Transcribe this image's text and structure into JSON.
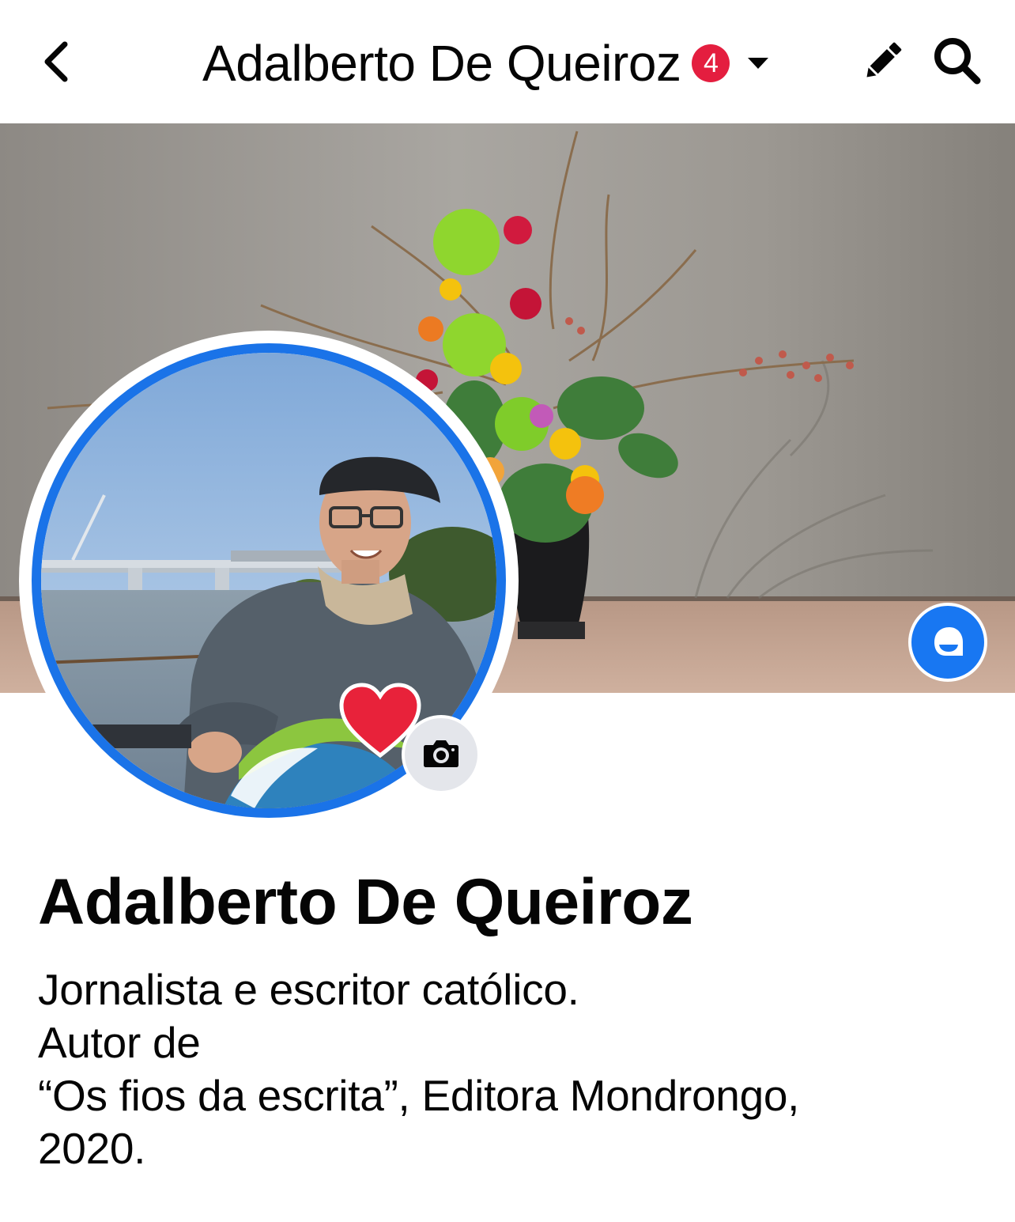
{
  "header": {
    "back_icon": "chevron-left-icon",
    "title": "Adalberto De Queiroz",
    "notification_count": "4",
    "badge_color": "#e41e3f",
    "dropdown_icon": "caret-down-icon",
    "edit_icon": "pencil-icon",
    "search_icon": "search-icon"
  },
  "cover": {
    "description_icon": "cover-photo",
    "buttons": [
      {
        "icon": "avatar-frame-icon",
        "color": "#1877f2"
      },
      {
        "icon": "camera-icon",
        "color": "#e4e6eb"
      }
    ]
  },
  "avatar": {
    "ring_color": "#1a73e8",
    "frame_icon": "heart-icon",
    "camera_icon": "camera-icon"
  },
  "profile": {
    "name": "Adalberto De Queiroz",
    "bio_lines": [
      "Jornalista e escritor católico.",
      "Autor de",
      "“Os fios da escrita”, Editora Mondrongo,",
      "2020."
    ]
  }
}
